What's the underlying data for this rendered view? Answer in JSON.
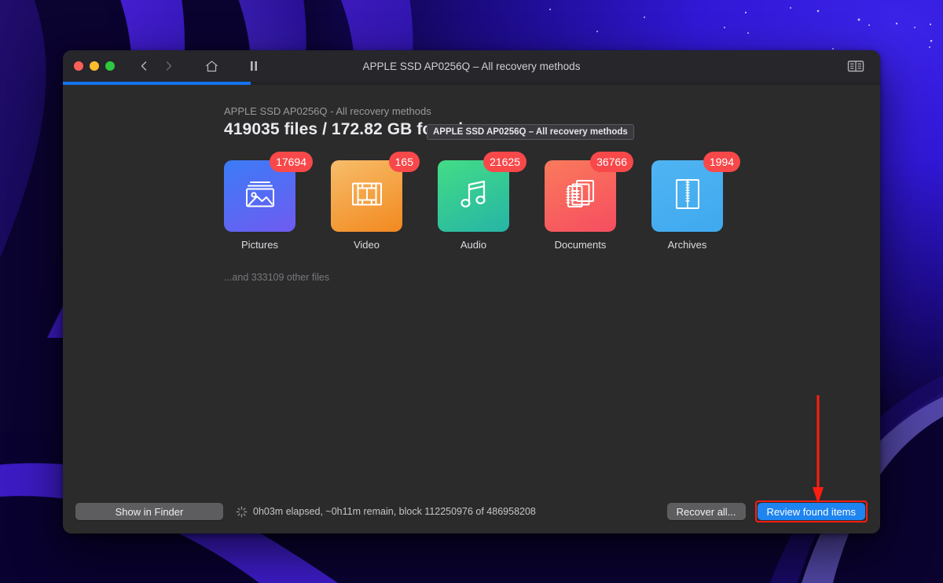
{
  "window": {
    "title": "APPLE SSD AP0256Q – All recovery methods",
    "tooltip": "APPLE SSD AP0256Q – All recovery methods",
    "traffic_lights": {
      "close": "close-button",
      "minimize": "minimize-button",
      "maximize": "maximize-button"
    },
    "toolbar": {
      "back_icon": "chevron-left-icon",
      "forward_icon": "chevron-right-icon",
      "home_icon": "home-icon",
      "pause_icon": "pause-icon",
      "sidebar_toggle_icon": "sidebar-toggle-icon"
    },
    "progress_percent": 23
  },
  "main": {
    "subtitle": "APPLE SSD AP0256Q - All recovery methods",
    "headline": "419035 files / 172.82 GB found",
    "other_files": "...and 333109 other files",
    "categories": [
      {
        "label": "Pictures",
        "count": "17694",
        "icon": "picture-icon",
        "color_from": "#3b7cf6",
        "color_to": "#6f5bf0"
      },
      {
        "label": "Video",
        "count": "165",
        "icon": "filmstrip-icon",
        "color_from": "#f7bd6a",
        "color_to": "#f2891f"
      },
      {
        "label": "Audio",
        "count": "21625",
        "icon": "music-note-icon",
        "color_from": "#42dd86",
        "color_to": "#26b4a6"
      },
      {
        "label": "Documents",
        "count": "36766",
        "icon": "documents-icon",
        "color_from": "#fa7a5c",
        "color_to": "#f64d60"
      },
      {
        "label": "Archives",
        "count": "1994",
        "icon": "archive-zip-icon",
        "color_from": "#50b4f2",
        "color_to": "#3fa9ef"
      }
    ],
    "badge_color": "#f8484a"
  },
  "footer": {
    "show_in_finder_label": "Show in Finder",
    "spinner_icon": "spinner-icon",
    "status_text": "0h03m elapsed, ~0h11m remain, block 112250976 of 486958208",
    "recover_all_label": "Recover all...",
    "review_found_items_label": "Review found items",
    "review_accent_color": "#1e84f0",
    "highlight_color": "#ff1d10"
  },
  "annotation": {
    "arrow_icon": "down-arrow-annotation",
    "arrow_color": "#ff1d10"
  }
}
